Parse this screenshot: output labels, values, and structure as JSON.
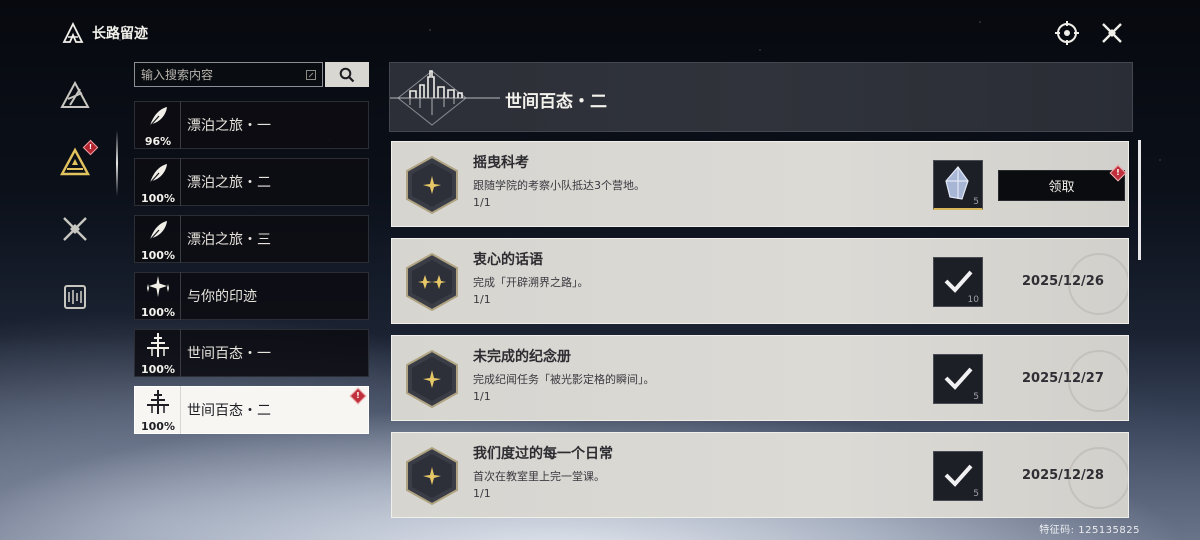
{
  "header": {
    "title": "长路留迹"
  },
  "search": {
    "placeholder": "输入搜索内容"
  },
  "categories": [
    {
      "name": "漂泊之旅・一",
      "percent": "96%",
      "icon": "feather-icon"
    },
    {
      "name": "漂泊之旅・二",
      "percent": "100%",
      "icon": "feather-icon"
    },
    {
      "name": "漂泊之旅・三",
      "percent": "100%",
      "icon": "feather-icon"
    },
    {
      "name": "与你的印迹",
      "percent": "100%",
      "icon": "sparkle-icon"
    },
    {
      "name": "世间百态・一",
      "percent": "100%",
      "icon": "tower-icon"
    },
    {
      "name": "世间百态・二",
      "percent": "100%",
      "icon": "tower-icon",
      "selected": true
    }
  ],
  "main": {
    "title": "世间百态・二"
  },
  "achievements": [
    {
      "title": "摇曳科考",
      "desc": "跟随学院的考察小队抵达3个营地。",
      "progress": "1/1",
      "reward_count": "5",
      "status": "claimable",
      "action_label": "领取"
    },
    {
      "title": "衷心的话语",
      "desc": "完成「开辟溯界之路」。",
      "progress": "1/1",
      "reward_count": "10",
      "status": "completed",
      "date": "2025/12/26"
    },
    {
      "title": "未完成的纪念册",
      "desc": "完成纪闻任务「被光影定格的瞬间」。",
      "progress": "1/1",
      "reward_count": "5",
      "status": "completed",
      "date": "2025/12/27"
    },
    {
      "title": "我们度过的每一个日常",
      "desc": "首次在教室里上完一堂课。",
      "progress": "1/1",
      "reward_count": "5",
      "status": "completed",
      "date": "2025/12/28"
    }
  ],
  "badge_symbol": "!",
  "uid": "特征码: 125135825",
  "colors": {
    "accent_gold": "#d8b659",
    "badge_red": "#c0303c",
    "card_bg": "#d7d5d0"
  }
}
